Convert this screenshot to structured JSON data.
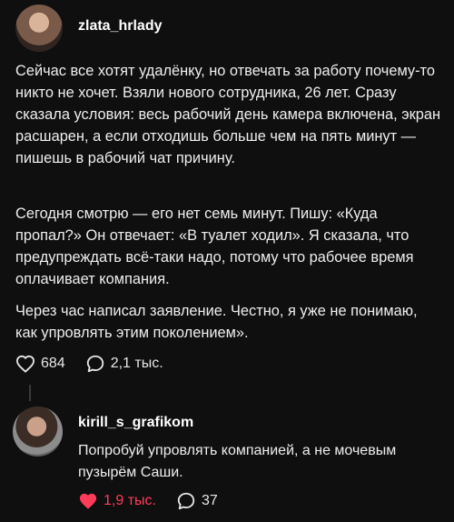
{
  "post": {
    "username": "zlata_hrlady",
    "paragraphs": [
      "Сейчас все хотят удалёнку, но отвечать за работу почему-то никто не хочет. Взяли нового сотрудника, 26 лет. Сразу сказала условия: весь рабочий день камера включена, экран расшарен, а если отходишь больше чем на пять минут — пишешь в рабочий чат причину.",
      "Сегодня смотрю — его нет семь минут. Пишу: «Куда пропал?» Он отвечает: «В туалет ходил». Я сказала, что предупреждать всё-таки надо, потому что рабочее время оплачивает компания.",
      "Через час написал заявление. Честно, я уже не понимаю, как упровлять этим поколением»."
    ],
    "likes": "684",
    "comments": "2,1 тыс."
  },
  "reply": {
    "username": "kirill_s_grafikom",
    "text": "Попробуй упровлять компанией, а не мочевым пузырём Саши.",
    "likes": "1,9 тыс.",
    "comments": "37"
  },
  "icons": {
    "like": "heart-outline-icon",
    "liked": "heart-filled-icon",
    "comment": "speech-bubble-icon"
  },
  "colors": {
    "background": "#0f0f0f",
    "text": "#eeeeee",
    "liked": "#ff3b5a"
  }
}
